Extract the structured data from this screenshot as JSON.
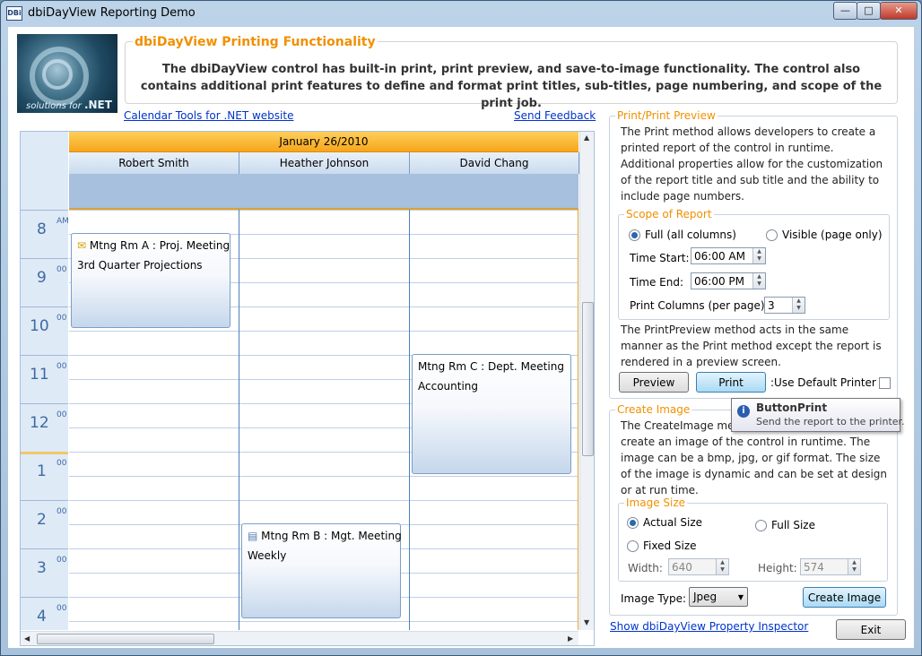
{
  "window": {
    "title": "dbiDayView Reporting Demo",
    "icon_text": "DBi",
    "controls": {
      "minimize": "—",
      "maximize": "□",
      "close": "✕"
    }
  },
  "header": {
    "logo_text": "solutions for",
    "logo_text_bold": ".NET",
    "title": "dbiDayView Printing Functionality",
    "description": "The dbiDayView control has built-in print, print preview, and save-to-image functionality. The control also contains additional print features to define and format print titles, sub-titles, page numbering, and scope of the print job."
  },
  "links": {
    "calendar_tools": "Calendar Tools for .NET website",
    "send_feedback": "Send Feedback",
    "property_inspector": "Show dbiDayView Property Inspector"
  },
  "calendar": {
    "date": "January 26/2010",
    "columns": [
      "Robert Smith",
      "Heather Johnson",
      "David Chang"
    ],
    "hours": [
      {
        "h": "8",
        "m": "AM"
      },
      {
        "h": "9",
        "m": "00"
      },
      {
        "h": "10",
        "m": "00"
      },
      {
        "h": "11",
        "m": "00"
      },
      {
        "h": "12",
        "m": "00"
      },
      {
        "h": "1",
        "m": "00"
      },
      {
        "h": "2",
        "m": "00"
      },
      {
        "h": "3",
        "m": "00"
      },
      {
        "h": "4",
        "m": "00"
      }
    ],
    "appointments": [
      {
        "title": "Mtng Rm A : Proj. Meeting",
        "subtitle": "3rd Quarter Projections",
        "icon": "bell-icon"
      },
      {
        "title": "Mtng Rm C : Dept. Meeting",
        "subtitle": "Accounting",
        "icon": ""
      },
      {
        "title": "Mtng Rm B : Mgt. Meeting",
        "subtitle": "Weekly",
        "icon": "note-icon"
      }
    ]
  },
  "print_panel": {
    "title": "Print/Print Preview",
    "description": "The Print method allows developers to create a printed report of the control in runtime. Additional properties allow for the customization of the report title and sub title and the ability to include page numbers.",
    "scope": {
      "title": "Scope of Report",
      "full_label": "Full (all columns)",
      "visible_label": "Visible (page only)",
      "selected": "full",
      "time_start_label": "Time Start:",
      "time_start": "06:00 AM",
      "time_end_label": "Time End:",
      "time_end": "06:00 PM",
      "columns_label": "Print Columns (per page):",
      "columns_value": "3"
    },
    "preview_description": "The PrintPreview method acts in the same manner as the Print method except the report is rendered in a preview screen.",
    "preview_button": "Preview",
    "print_button": "Print",
    "default_printer_label": ":Use Default Printer",
    "default_printer_checked": false
  },
  "tooltip": {
    "title": "ButtonPrint",
    "text": "Send the report to the printer."
  },
  "image_panel": {
    "title": "Create Image",
    "description_line1": "The CreateImage meth",
    "description": "create an image of the control in runtime. The image can be a bmp, jpg, or gif format. The size of the image is dynamic and can be set at design or at run time.",
    "size": {
      "title": "Image Size",
      "actual_label": "Actual Size",
      "full_label": "Full Size",
      "fixed_label": "Fixed Size",
      "selected": "actual",
      "width_label": "Width:",
      "width_value": "640",
      "height_label": "Height:",
      "height_value": "574"
    },
    "type_label": "Image Type:",
    "type_value": "Jpeg",
    "create_button": "Create Image"
  },
  "exit_button": "Exit"
}
